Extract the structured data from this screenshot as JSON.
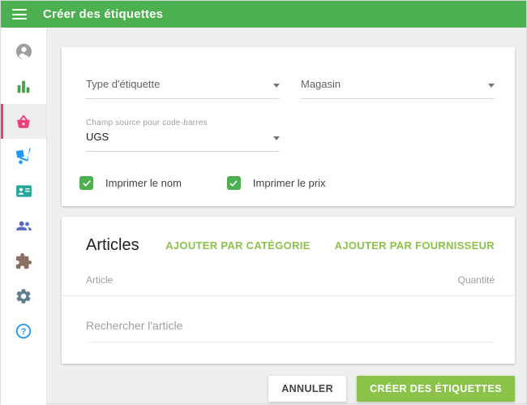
{
  "header": {
    "title": "Créer des étiquettes",
    "bg_color": "#4caf50"
  },
  "sidebar": {
    "items": [
      {
        "id": "account",
        "icon": "account-icon",
        "color": "#9e9e9e",
        "active": false
      },
      {
        "id": "reports",
        "icon": "reports-bar-chart-icon",
        "color": "#43a047",
        "active": false
      },
      {
        "id": "items",
        "icon": "items-basket-icon",
        "color": "#ec407a",
        "active": true
      },
      {
        "id": "inventory",
        "icon": "inventory-dolly-icon",
        "color": "#2196f3",
        "active": false
      },
      {
        "id": "employees",
        "icon": "employee-badge-icon",
        "color": "#26a69a",
        "active": false
      },
      {
        "id": "customers",
        "icon": "customers-people-icon",
        "color": "#5c6bc0",
        "active": false
      },
      {
        "id": "integrations",
        "icon": "integrations-puzzle-icon",
        "color": "#8d6e63",
        "active": false
      },
      {
        "id": "settings",
        "icon": "settings-gear-icon",
        "color": "#607d8b",
        "active": false
      },
      {
        "id": "help",
        "icon": "help-icon",
        "color": "#2196f3",
        "active": false
      }
    ],
    "active_highlight_color": "#ec407a"
  },
  "form": {
    "label_type": {
      "label": "Type d'étiquette",
      "value": ""
    },
    "store": {
      "label": "Magasin",
      "value": ""
    },
    "barcode_source": {
      "label": "Champ source pour code-barres",
      "value": "UGS"
    },
    "checkboxes": [
      {
        "label": "Imprimer le nom",
        "checked": true
      },
      {
        "label": "Imprimer le prix",
        "checked": true
      }
    ],
    "checkbox_color": "#4caf50"
  },
  "articles": {
    "title": "Articles",
    "add_by_category_label": "AJOUTER PAR CATÉGORIE",
    "add_by_supplier_label": "AJOUTER PAR FOURNISSEUR",
    "columns": {
      "article": "Article",
      "quantity": "Quantité"
    },
    "search_placeholder": "Rechercher l'article",
    "rows": []
  },
  "footer": {
    "cancel_label": "ANNULER",
    "create_label": "CRÉER DES ÉTIQUETTES",
    "primary_color": "#8bc34a"
  }
}
